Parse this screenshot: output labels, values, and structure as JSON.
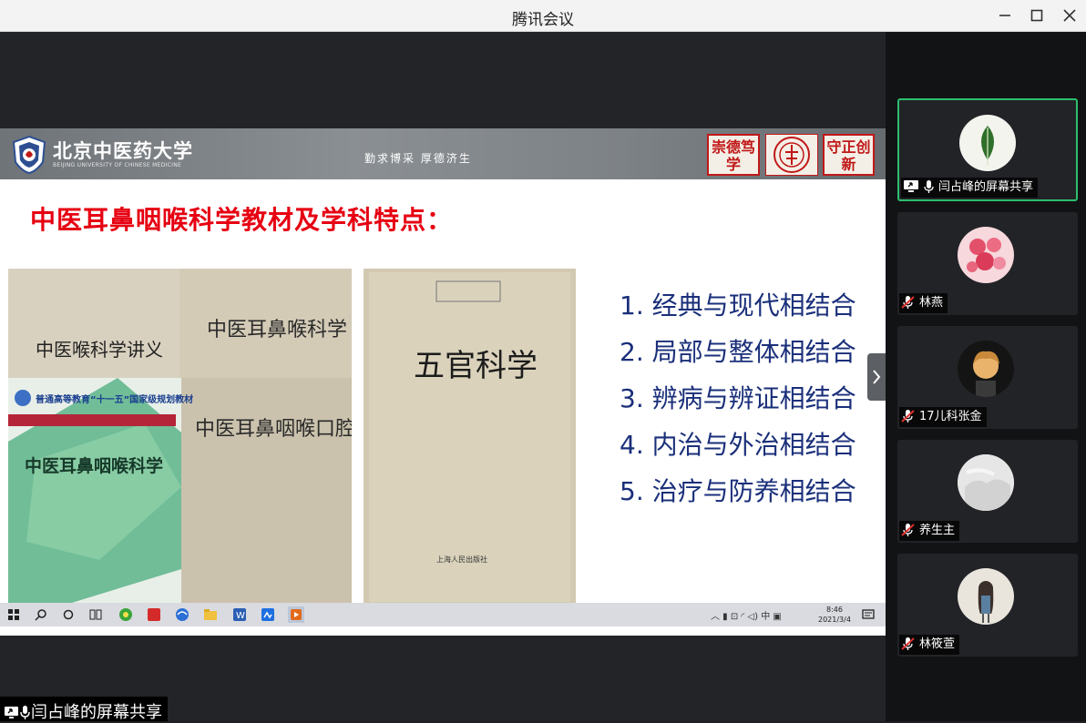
{
  "window": {
    "title": "腾讯会议"
  },
  "slide": {
    "university_name": "北京中医药大学",
    "university_name_en": "BEIJING UNIVERSITY OF CHINESE MEDICINE",
    "motto": "勤求博采  厚德济生",
    "badge_left": "崇德笃学",
    "badge_right": "守正创新",
    "title": "中医耳鼻咽喉科学教材及学科特点：",
    "points": [
      "1. 经典与现代相结合",
      "2. 局部与整体相结合",
      "3. 辨病与辨证相结合",
      "4. 内治与外治相结合",
      "5. 治疗与防养相结合"
    ],
    "books": {
      "book1_title": "中医喉科学讲义",
      "book2_title": "中医耳鼻喉科学",
      "book3_banner": "普通高等教育“十一五”国家级规划教材",
      "book3_title": "中医耳鼻咽喉科学",
      "book4_title": "中医耳鼻咽喉口腔科学",
      "book5_title": "五官科学",
      "book5_publisher": "上海人民出版社"
    }
  },
  "taskbar": {
    "ime": "中",
    "time": "8:46",
    "date": "2021/3/4"
  },
  "share_label": "闫占峰的屏幕共享",
  "participants": [
    {
      "name": "闫占峰的屏幕共享",
      "state": "sharing",
      "mic": "on"
    },
    {
      "name": "林燕",
      "state": "muted",
      "mic": "off"
    },
    {
      "name": "17儿科张金",
      "state": "muted",
      "mic": "off"
    },
    {
      "name": "养生主",
      "state": "muted",
      "mic": "off"
    },
    {
      "name": "林筱萱",
      "state": "muted",
      "mic": "off"
    }
  ],
  "colors": {
    "title_red": "#e60012",
    "points_blue": "#1a2f7a",
    "active_border": "#2dbd6e",
    "muted_red": "#e0302c"
  }
}
